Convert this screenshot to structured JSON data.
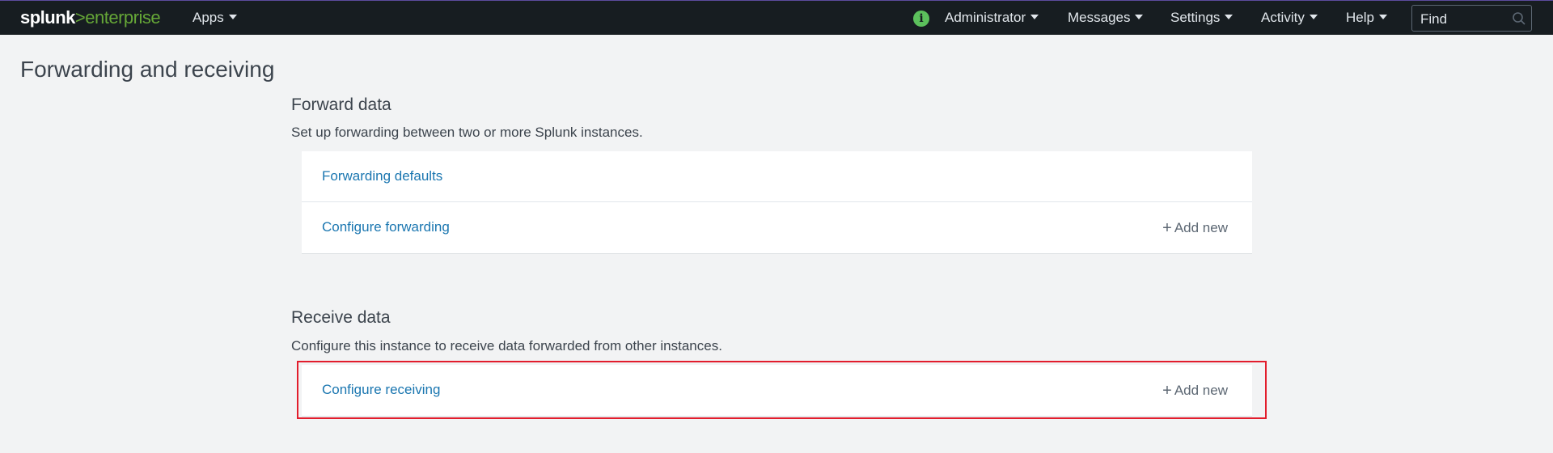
{
  "topbar": {
    "logo_word": "splunk",
    "logo_arrow": ">",
    "logo_product": "enterprise",
    "apps": "Apps",
    "administrator": "Administrator",
    "messages": "Messages",
    "settings": "Settings",
    "activity": "Activity",
    "help": "Help",
    "find_placeholder": "Find",
    "info_icon": "i"
  },
  "page": {
    "title": "Forwarding and receiving"
  },
  "forward": {
    "title": "Forward data",
    "description": "Set up forwarding between two or more Splunk instances.",
    "rows": [
      {
        "label": "Forwarding defaults"
      },
      {
        "label": "Configure forwarding",
        "action": "Add new"
      }
    ]
  },
  "receive": {
    "title": "Receive data",
    "description": "Configure this instance to receive data forwarded from other instances.",
    "rows": [
      {
        "label": "Configure receiving",
        "action": "Add new"
      }
    ]
  },
  "colors": {
    "topbar_bg": "#171d21",
    "link": "#1a76b0",
    "logo_green": "#65a637",
    "highlight": "#e21d2c"
  }
}
